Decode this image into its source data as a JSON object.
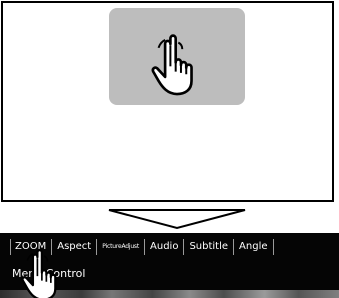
{
  "tabs": [
    "ZOOM",
    "Aspect",
    "PictureAdjust",
    "Audio",
    "Subtitle",
    "Angle"
  ],
  "menu_label": "Menu Control",
  "colors": {
    "touch_area": "#bdbdbd",
    "bar": "#050505",
    "text": "#ffffff"
  },
  "icons": {
    "touch": "hand-pointer-icon",
    "down": "arrow-down-icon"
  }
}
